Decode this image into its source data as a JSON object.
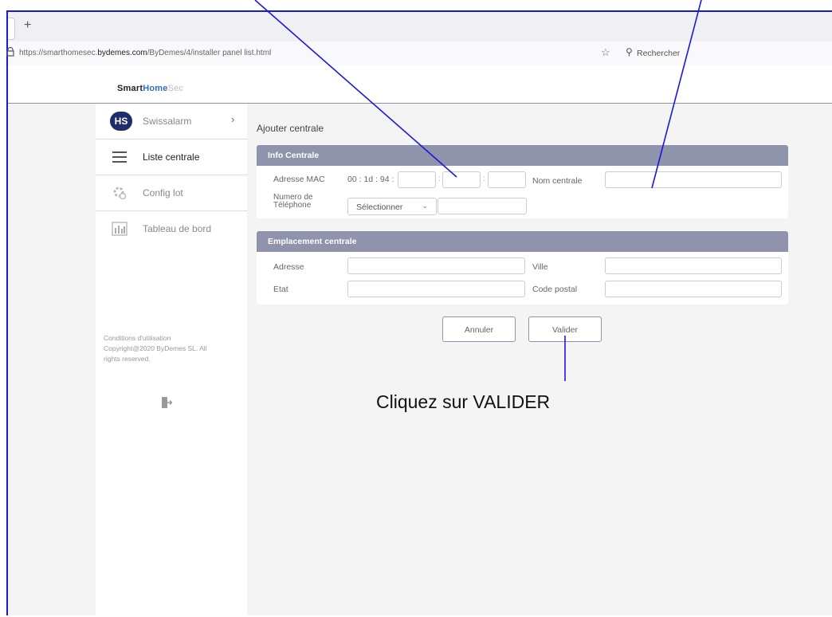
{
  "browser": {
    "tab_new": "+",
    "url_prefix": "https://smarthomesec.",
    "url_domain": "bydemes.com",
    "url_suffix": "/ByDemes/4/installer panel list.html",
    "search_placeholder": "Rechercher"
  },
  "app": {
    "logo_part1": "Smart",
    "logo_part2": "Home",
    "logo_part3": "Sec"
  },
  "sidebar": {
    "user_initials": "HS",
    "user_name": "Swissalarm",
    "items": [
      {
        "label": "Liste centrale",
        "icon": "list-icon"
      },
      {
        "label": "Config lot",
        "icon": "gear-icon"
      },
      {
        "label": "Tableau de bord",
        "icon": "dashboard-icon"
      }
    ],
    "terms_1": "Conditions d'utilisation",
    "terms_2": "Copyright@2020 ByDemes SL. All",
    "terms_3": "rights reserved."
  },
  "main": {
    "title": "Ajouter centrale",
    "info": {
      "header": "Info Centrale",
      "mac_label": "Adresse MAC",
      "mac_prefix": "00 : 1d : 94 :",
      "mac_sep": ":",
      "name_label": "Nom centrale",
      "phone_label_1": "Numero de",
      "phone_label_2": "Téléphone",
      "phone_select": "Sélectionner"
    },
    "location": {
      "header": "Emplacement centrale",
      "address_label": "Adresse",
      "city_label": "Ville",
      "state_label": "Etat",
      "zip_label": "Code postal"
    },
    "cancel_label": "Annuler",
    "submit_label": "Valider"
  },
  "annotation": {
    "text": "Cliquez sur VALIDER",
    "color": "#1a1ad6"
  }
}
